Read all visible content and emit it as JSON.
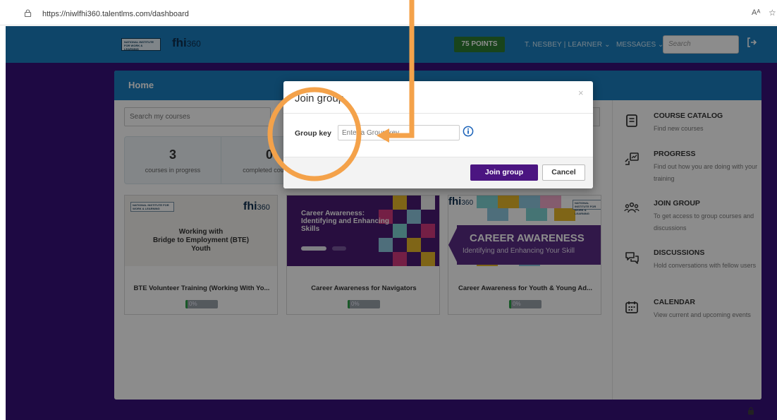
{
  "browser": {
    "url": "https://niwlfhi360.talentlms.com/dashboard",
    "read_aloud": "Aᴬ"
  },
  "topnav": {
    "logo_niwl": "NATIONAL INSTITUTE FOR WORK & LEARNING",
    "logo_fhi": "fhi",
    "logo_fhi_num": "360",
    "points": "75 POINTS",
    "user": "T. NESBEY | LEARNER ⌄",
    "messages": "MESSAGES ⌄",
    "search_placeholder": "Search"
  },
  "panel": {
    "title": "Home",
    "search_placeholder": "Search my courses",
    "stats": [
      {
        "num": "3",
        "label": "courses in progress"
      },
      {
        "num": "0",
        "label": "completed courses"
      }
    ]
  },
  "courses": [
    {
      "title": "BTE Volunteer Training (Working With Yo...",
      "progress_text": "0%",
      "progress": 0,
      "thumb_text": "Working with\nBridge to Employment (BTE)\nYouth"
    },
    {
      "title": "Career Awareness for Navigators",
      "progress_text": "0%",
      "progress": 0,
      "thumb_text": "Career Awareness:\nIdentifying and Enhancing\nSkills"
    },
    {
      "title": "Career Awareness for Youth & Young Ad...",
      "progress_text": "0%",
      "progress": 0,
      "thumb_banner_title": "CAREER AWARENESS",
      "thumb_banner_sub": "Identifying and Enhancing Your Skill"
    }
  ],
  "sidebar": [
    {
      "icon": "book-icon",
      "title": "COURSE CATALOG",
      "desc": "Find new courses"
    },
    {
      "icon": "progress-chart-icon",
      "title": "PROGRESS",
      "desc": "Find out how you are doing with your training"
    },
    {
      "icon": "group-icon",
      "title": "JOIN GROUP",
      "desc": "To get access to group courses and discussions"
    },
    {
      "icon": "chat-bubbles-icon",
      "title": "DISCUSSIONS",
      "desc": "Hold conversations with fellow users"
    },
    {
      "icon": "calendar-icon",
      "title": "CALENDAR",
      "desc": "View current and upcoming events"
    }
  ],
  "modal": {
    "title": "Join group",
    "close": "×",
    "group_key_label": "Group key",
    "group_key_placeholder": "Enter a Group key",
    "join_label": "Join group",
    "cancel_label": "Cancel"
  },
  "colors": {
    "brand_blue": "#1a7fc0",
    "brand_purple": "#4b1581",
    "points_green": "#2e7d32",
    "annotation_orange": "#f4a24a"
  }
}
